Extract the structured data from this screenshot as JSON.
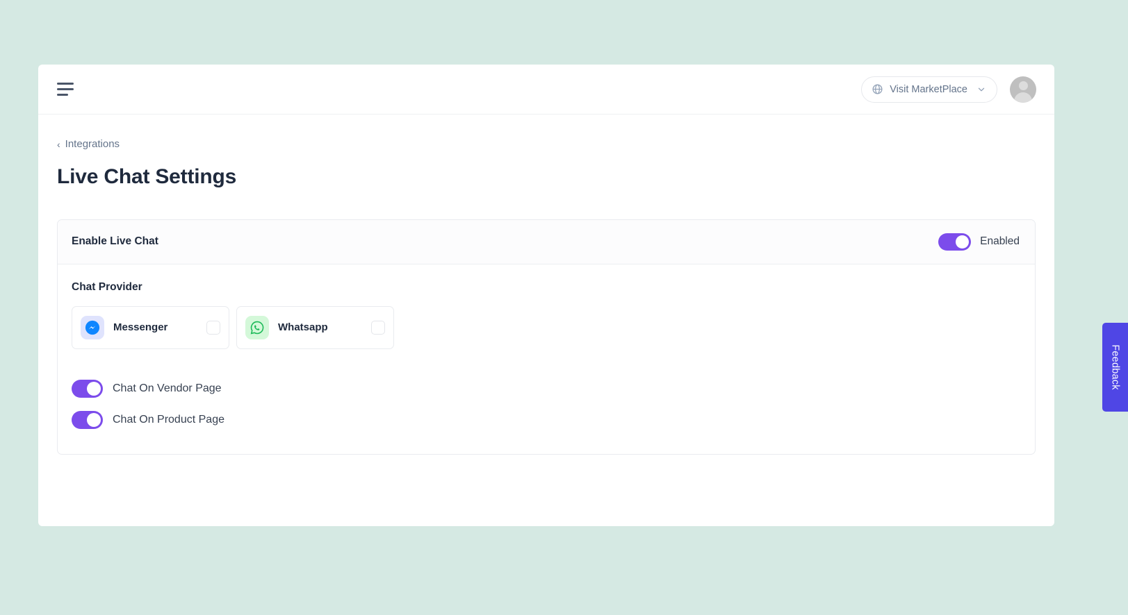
{
  "topbar": {
    "menu_icon": "hamburger-icon",
    "marketplace_button": {
      "label": "Visit MarketPlace",
      "globe_icon": "globe-icon",
      "chevron_icon": "chevron-down-icon"
    },
    "avatar": "user-avatar"
  },
  "breadcrumb": {
    "caret": "‹",
    "label": "Integrations"
  },
  "page": {
    "title": "Live Chat Settings"
  },
  "card": {
    "header": {
      "title": "Enable Live Chat",
      "toggle_state": "on",
      "toggle_label": "Enabled"
    },
    "provider_section": {
      "label": "Chat Provider",
      "providers": [
        {
          "name": "Messenger",
          "icon": "messenger-icon",
          "icon_bg": "#dfe3fd",
          "icon_color": "#0084ff",
          "checked": false
        },
        {
          "name": "Whatsapp",
          "icon": "whatsapp-icon",
          "icon_bg": "#d4f8d9",
          "icon_color": "#25d366",
          "checked": false
        }
      ]
    },
    "options": [
      {
        "label": "Chat On Vendor Page",
        "state": "on"
      },
      {
        "label": "Chat On Product Page",
        "state": "on"
      }
    ]
  },
  "feedback_tab": {
    "label": "Feedback",
    "color": "#4f46e5"
  },
  "colors": {
    "page_background": "#d5e9e3",
    "accent_purple": "#7c4ceb",
    "title": "#1f2a3d"
  }
}
